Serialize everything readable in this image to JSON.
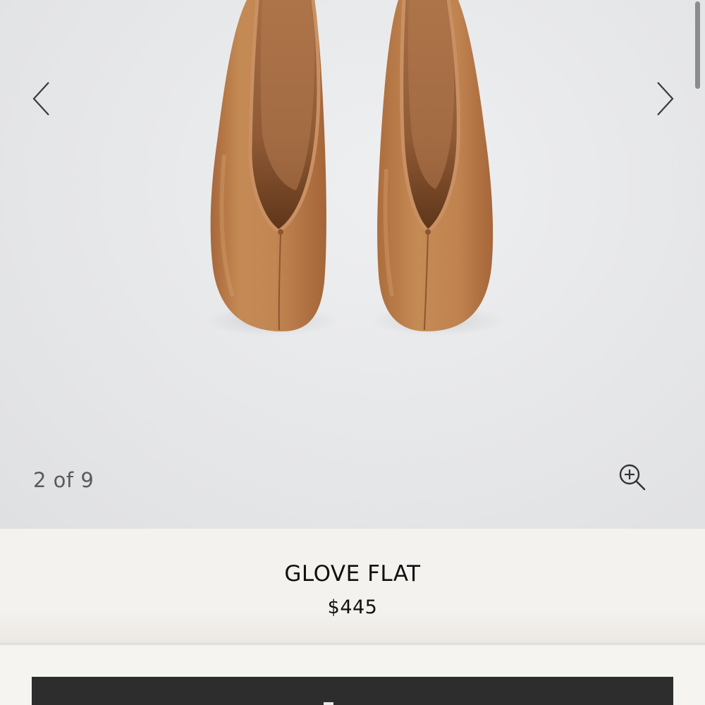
{
  "gallery": {
    "counter": "2 of 9",
    "prev_icon": "chevron-left-icon",
    "next_icon": "chevron-right-icon",
    "zoom_icon": "zoom-in-icon"
  },
  "product": {
    "name": "GLOVE FLAT",
    "price": "$445",
    "color": "#b57a46"
  },
  "colors": {
    "background": "#f4f2ef",
    "photo_backdrop": "#e6e7e9",
    "button": "#2d2d2d",
    "text": "#111111"
  }
}
